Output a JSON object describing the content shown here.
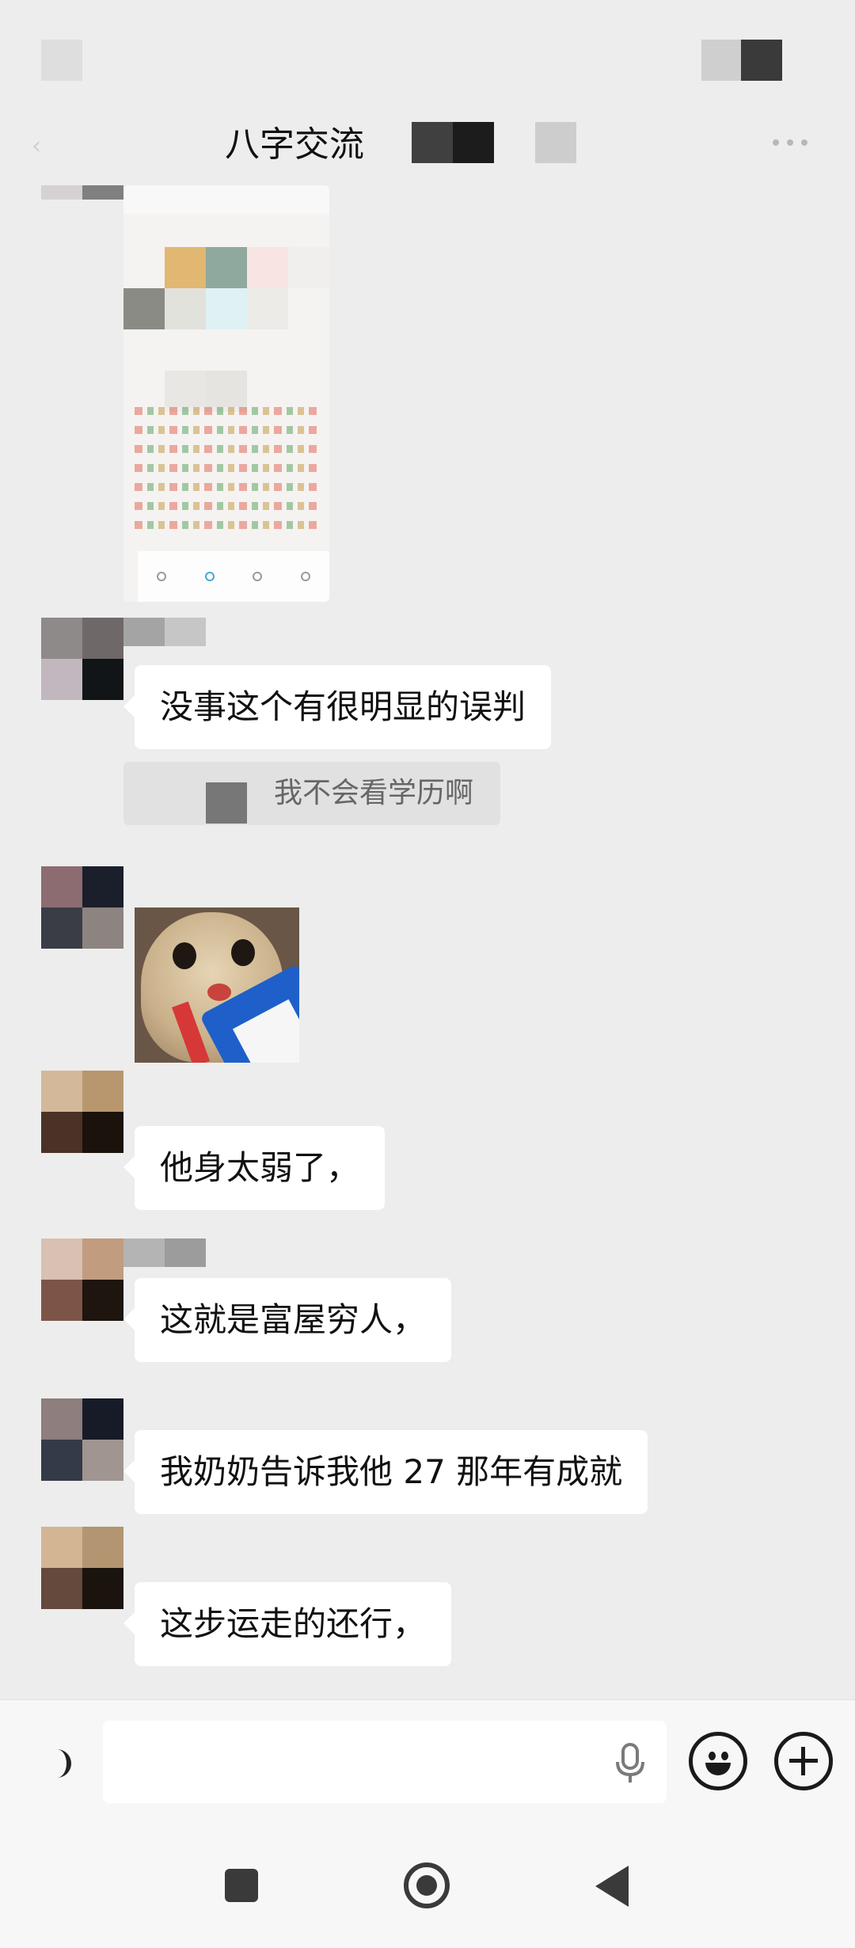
{
  "header": {
    "title": "八字交流"
  },
  "messages": [
    {
      "type": "image",
      "content": "screenshot"
    },
    {
      "type": "text",
      "text": "没事这个有很明显的误判"
    },
    {
      "type": "quote",
      "text": "我不会看学历啊"
    },
    {
      "type": "sticker",
      "content": "cat-with-book"
    },
    {
      "type": "text",
      "text": "他身太弱了，"
    },
    {
      "type": "text",
      "text": "这就是富屋穷人，"
    },
    {
      "type": "text",
      "text": "我奶奶告诉我他 27 那年有成就"
    },
    {
      "type": "text",
      "text": "这步运走的还行，"
    }
  ],
  "input": {
    "placeholder": ""
  },
  "icons": {
    "back": "back-icon",
    "more": "more-icon",
    "voice": "voice-toggle-icon",
    "mic": "mic-icon",
    "emoji": "emoji-icon",
    "plus": "plus-icon",
    "nav_recent": "recent-apps-icon",
    "nav_home": "home-icon",
    "nav_back": "back-triangle-icon"
  },
  "colors": {
    "background": "#ededed",
    "bubble": "#ffffff",
    "text": "#111111",
    "quote_bg": "#e1e1e1",
    "quote_text": "#666666"
  }
}
